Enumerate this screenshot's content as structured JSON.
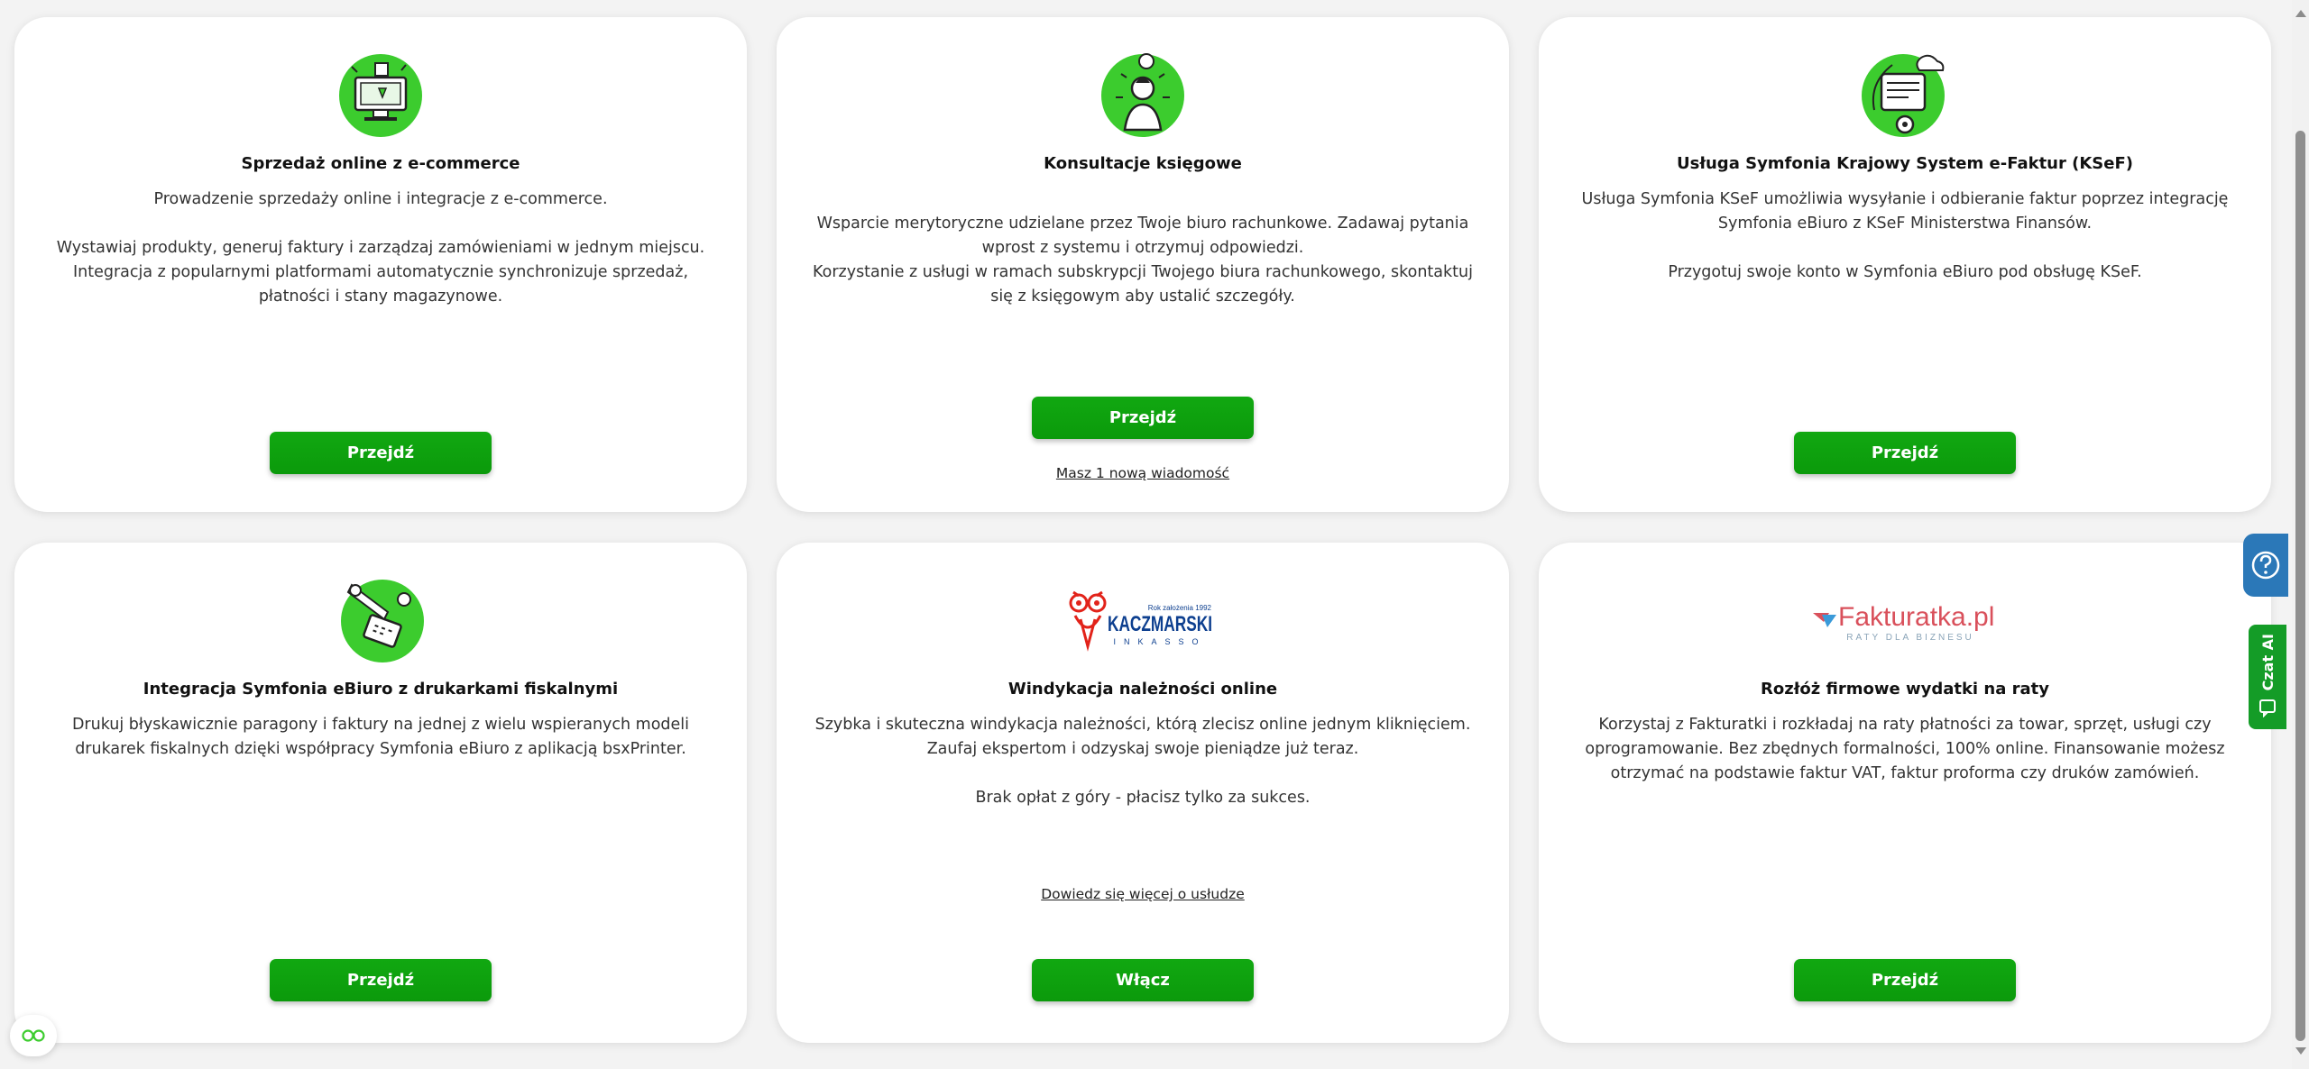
{
  "cards": [
    {
      "icon": "ecommerce-icon",
      "title": "Sprzedaż online z e-commerce",
      "desc": [
        "Prowadzenie sprzedaży online i integracje z e-commerce.",
        "Wystawiaj produkty, generuj faktury i zarządzaj zamówieniami w jednym miejscu. Integracja z popularnymi platformami automatycznie synchronizuje sprzedaż, płatności i stany magazynowe."
      ],
      "button": "Przejdź"
    },
    {
      "icon": "accounting-consultation-icon",
      "title": "Konsultacje księgowe",
      "desc": [
        "Wsparcie merytoryczne udzielane przez Twoje biuro rachunkowe. Zadawaj pytania wprost z systemu i otrzymuj odpowiedzi.\nKorzystanie z usługi w ramach subskrypcji Twojego biura rachunkowego, skontaktuj się z księgowym aby ustalić szczegóły."
      ],
      "button": "Przejdź",
      "link": "Masz 1 nową wiadomość"
    },
    {
      "icon": "ksef-icon",
      "title": "Usługa Symfonia Krajowy System e-Faktur (KSeF)",
      "desc": [
        "Usługa Symfonia KSeF umożliwia wysyłanie i odbieranie faktur poprzez integrację Symfonia eBiuro z KSeF Ministerstwa Finansów.",
        "Przygotuj swoje konto w Symfonia eBiuro pod obsługę KSeF."
      ],
      "button": "Przejdź"
    },
    {
      "icon": "fiscal-printer-icon",
      "title": "Integracja Symfonia eBiuro z drukarkami fiskalnymi",
      "desc": [
        "Drukuj błyskawicznie paragony i faktury na jednej z wielu wspieranych modeli drukarek fiskalnych dzięki współpracy Symfonia eBiuro z aplikacją bsxPrinter."
      ],
      "button": "Przejdź"
    },
    {
      "icon": "kaczmarski-logo",
      "logo": {
        "tag": "Rok założenia 1992",
        "name": "KACZMARSKI",
        "sub": "INKASSO"
      },
      "title": "Windykacja należności online",
      "desc": [
        "Szybka i skuteczna windykacja należności, którą zlecisz online jednym kliknięciem. Zaufaj ekspertom i odzyskaj swoje pieniądze już teraz.",
        "Brak opłat z góry - płacisz tylko za sukces."
      ],
      "button": "Włącz",
      "link": "Dowiedz się więcej o usłudze"
    },
    {
      "icon": "fakturatka-logo",
      "logo": {
        "name": "Fakturatka.pl",
        "sub": "RATY DLA BIZNESU"
      },
      "title": "Rozłóż firmowe wydatki na raty",
      "desc": [
        "Korzystaj z Fakturatki i rozkładaj na raty płatności za towar, sprzęt, usługi czy oprogramowanie. Bez zbędnych formalności, 100% online. Finansowanie możesz otrzymać na podstawie faktur VAT, faktur proforma czy druków zamówień."
      ],
      "button": "Przejdź"
    }
  ],
  "widgets": {
    "chat_label": "Czat AI",
    "help_icon": "question-icon",
    "bottom_icon": "glasses-icon"
  },
  "colors": {
    "primary_green": "#0b9a0b",
    "help_blue": "#2b78b8",
    "chat_green": "#149c27",
    "fakturatka_red": "#d9505b",
    "kaczmarski_blue": "#0d3f8f",
    "kaczmarski_red": "#e2231a"
  }
}
